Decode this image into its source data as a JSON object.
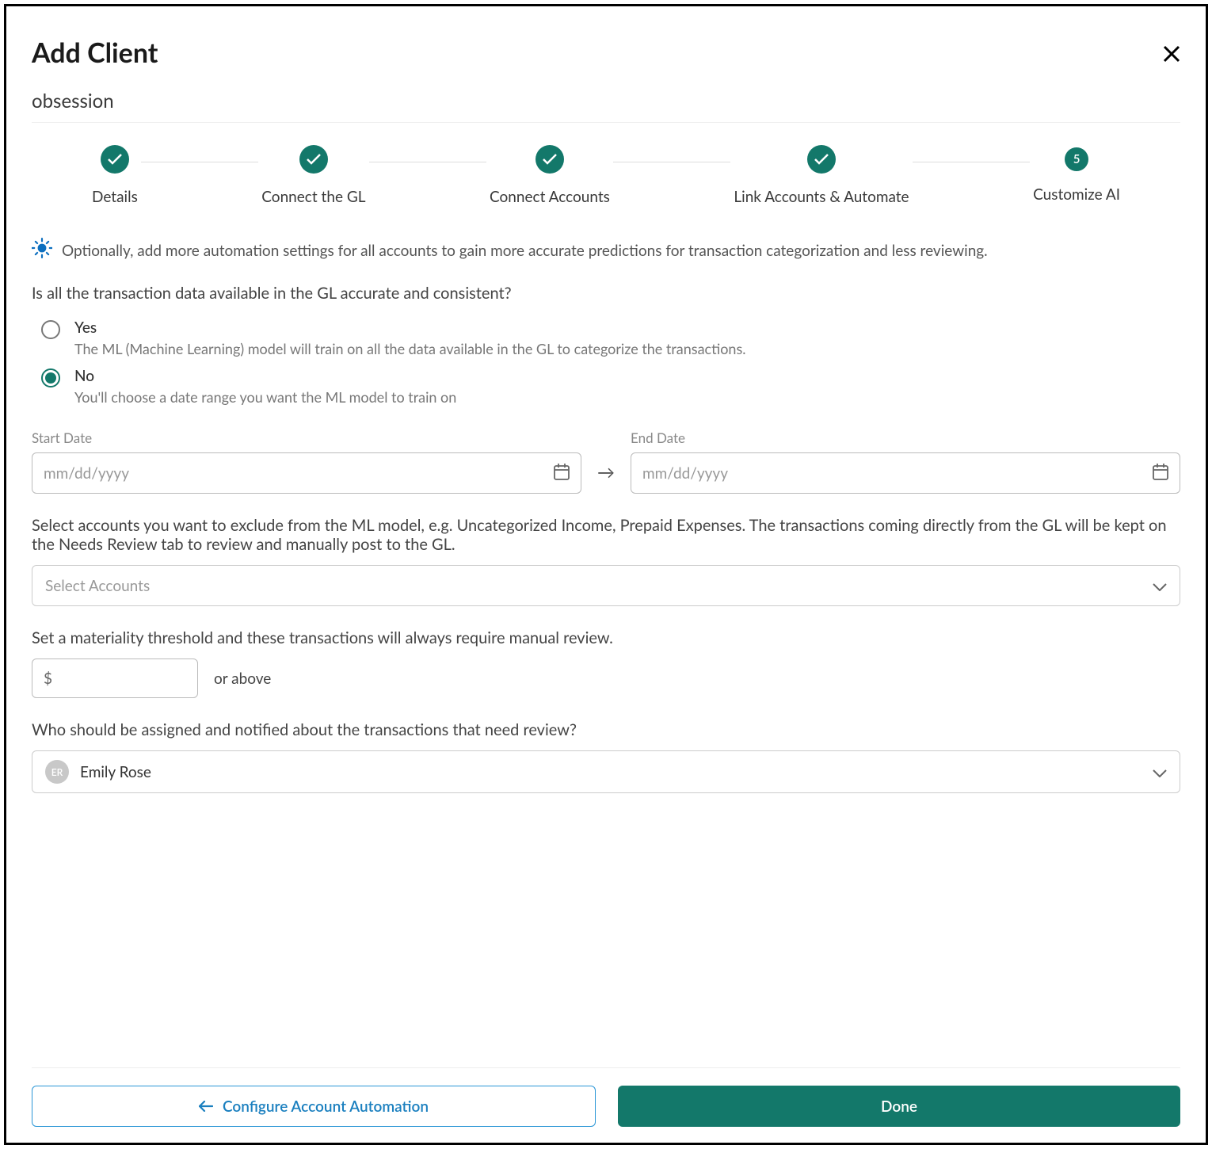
{
  "header": {
    "title": "Add Client",
    "subtitle": "obsession"
  },
  "stepper": {
    "step1": "Details",
    "step2": "Connect the GL",
    "step3": "Connect Accounts",
    "step4": "Link Accounts & Automate",
    "step5": "Customize AI",
    "step5_num": "5"
  },
  "info": {
    "text": "Optionally, add more automation settings for all accounts to gain more accurate predictions for transaction categorization and less reviewing."
  },
  "q1": {
    "question": "Is all the transaction data available in the GL accurate and consistent?",
    "yes_label": "Yes",
    "yes_desc": "The ML (Machine Learning) model will train on all the data available in the GL to categorize the transactions.",
    "no_label": "No",
    "no_desc": "You'll choose a date range you want the ML model to train on"
  },
  "dates": {
    "start_label": "Start Date",
    "end_label": "End Date",
    "placeholder": "mm/dd/yyyy",
    "arrow": "→"
  },
  "exclude": {
    "text": "Select accounts you want to exclude from the ML model, e.g. Uncategorized Income, Prepaid Expenses. The transactions coming directly from the GL will be kept on the Needs Review tab to review and manually post to the GL.",
    "placeholder": "Select Accounts"
  },
  "threshold": {
    "text": "Set a materiality threshold and these transactions will always require manual review.",
    "prefix": "$",
    "suffix": "or above"
  },
  "assignee": {
    "text": "Who should be assigned and notified about the transactions that need review?",
    "initials": "ER",
    "name": "Emily Rose"
  },
  "footer": {
    "back_label": "Configure Account Automation",
    "done_label": "Done"
  }
}
